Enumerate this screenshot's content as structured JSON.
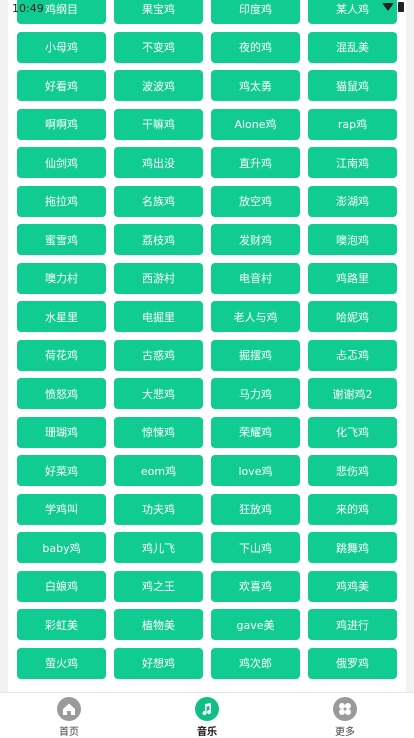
{
  "status_bar": {
    "time": "10:49"
  },
  "colors": {
    "accent": "#11cc91",
    "active_nav": "#0fbf87",
    "inactive_nav": "#9a9a9a"
  },
  "tags": [
    "鸡纲目",
    "果宝鸡",
    "印度鸡",
    "某人鸡",
    "小母鸡",
    "不变鸡",
    "夜的鸡",
    "混乱美",
    "好看鸡",
    "波波鸡",
    "鸡太勇",
    "猫鼠鸡",
    "啊啊鸡",
    "干嘛鸡",
    "Alone鸡",
    "rap鸡",
    "仙剑鸡",
    "鸡出没",
    "直升鸡",
    "江南鸡",
    "拖拉鸡",
    "名族鸡",
    "放空鸡",
    "澎湖鸡",
    "蜜雪鸡",
    "荔枝鸡",
    "发财鸡",
    "噢泡鸡",
    "噢力村",
    "西游村",
    "电音村",
    "鸡路里",
    "水星里",
    "电掘里",
    "老人与鸡",
    "哈妮鸡",
    "荷花鸡",
    "古惑鸡",
    "掘摆鸡",
    "忐忑鸡",
    "愤怒鸡",
    "大悲鸡",
    "马力鸡",
    "谢谢鸡2",
    "珊瑚鸡",
    "惊悚鸡",
    "荣耀鸡",
    "化飞鸡",
    "好菜鸡",
    "eom鸡",
    "love鸡",
    "悲伤鸡",
    "学鸡叫",
    "功夫鸡",
    "狂放鸡",
    "来的鸡",
    "baby鸡",
    "鸡儿飞",
    "下山鸡",
    "跳舞鸡",
    "白娘鸡",
    "鸡之王",
    "欢喜鸡",
    "鸡鸡美",
    "彩虹美",
    "植物美",
    "gave美",
    "鸡进行",
    "萤火鸡",
    "好想鸡",
    "鸡次郎",
    "俄罗鸡"
  ],
  "nav": {
    "home": {
      "label": "首页",
      "icon": "home-icon"
    },
    "music": {
      "label": "音乐",
      "icon": "music-note-icon"
    },
    "more": {
      "label": "更多",
      "icon": "grid-more-icon"
    }
  }
}
